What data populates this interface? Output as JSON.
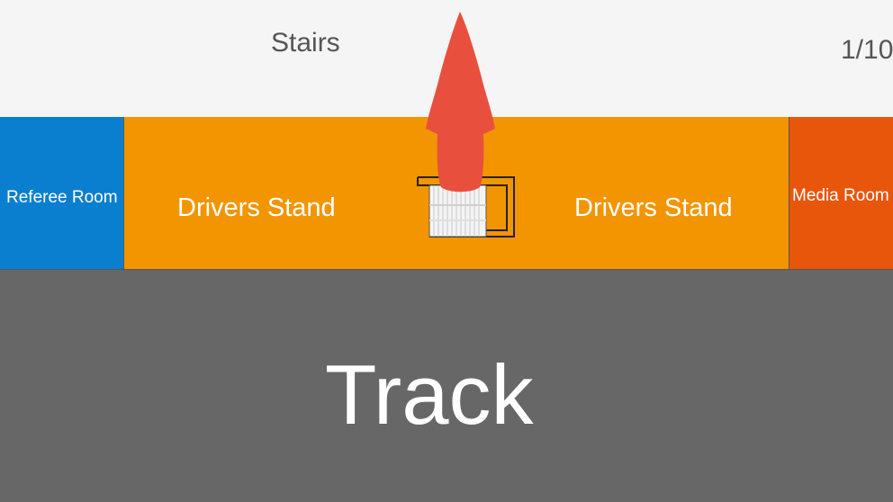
{
  "header": {
    "stairs_label": "Stairs",
    "slide_number": "1/10"
  },
  "zones": {
    "referee_room": "Referee Room",
    "drivers_stand_left": "Drivers Stand",
    "drivers_stand_right": "Drivers Stand",
    "media_room": "Media Room",
    "track": "Track"
  },
  "colors": {
    "background": "#f5f5f5",
    "referee_room": "#0b7fcf",
    "drivers_stand": "#f29500",
    "media_room": "#e8560b",
    "track": "#676767",
    "arrow": "#e94f3d"
  },
  "icons": {
    "stairs": "stairs-icon",
    "direction": "red-up-arrow-icon"
  }
}
